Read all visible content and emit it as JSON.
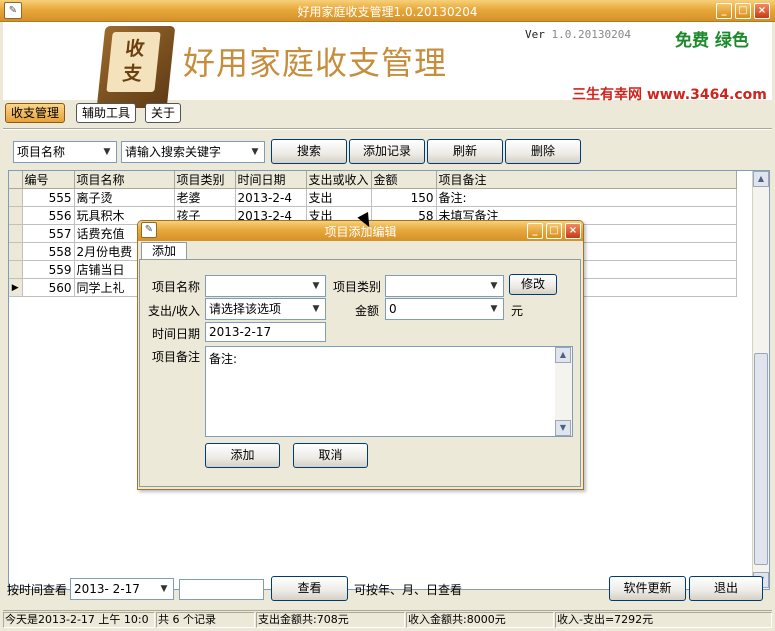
{
  "window": {
    "title": "好用家庭收支管理1.0.20130204",
    "icon": "app-book-icon"
  },
  "header": {
    "logo_text_1": "收",
    "logo_text_2": "支",
    "app_title": "好用家庭收支管理",
    "version_prefix": "Ver",
    "version_num": "1.0.20130204",
    "slogan": "免费 绿色",
    "site": "三生有幸网 www.3464.com"
  },
  "menu": [
    {
      "label": "收支管理",
      "active": true
    },
    {
      "label": "辅助工具",
      "active": false
    },
    {
      "label": "关于",
      "active": false
    }
  ],
  "search": {
    "field_select": "项目名称",
    "keyword_placeholder": "请输入搜索关键字",
    "search_btn": "搜索",
    "add_btn": "添加记录",
    "refresh_btn": "刷新",
    "delete_btn": "删除"
  },
  "grid": {
    "columns": [
      "编号",
      "项目名称",
      "项目类别",
      "时间日期",
      "支出或收入",
      "金额",
      "项目备注"
    ],
    "rows": [
      [
        "555",
        "离子烫",
        "老婆",
        "2013-2-4",
        "支出",
        "150",
        "备注:"
      ],
      [
        "556",
        "玩具积木",
        "孩子",
        "2013-2-4",
        "支出",
        "58",
        "未填写备注"
      ],
      [
        "557",
        "话费充值",
        "",
        "",
        "",
        "",
        ""
      ],
      [
        "558",
        "2月份电费",
        "",
        "",
        "",
        "",
        ""
      ],
      [
        "559",
        "店铺当日",
        "",
        "",
        "",
        "",
        ""
      ],
      [
        "560",
        "同学上礼",
        "",
        "",
        "",
        "",
        ""
      ]
    ],
    "current_row_index": 5
  },
  "bottom": {
    "date_label": "按时间查看",
    "date_value": "2013- 2-17",
    "view_btn": "查看",
    "hint": "可按年、月、日查看",
    "update_btn": "软件更新",
    "exit_btn": "退出"
  },
  "status": {
    "today": "今天是2013-2-17 上午 10:0",
    "records": "共 6 个记录",
    "expense_total": "支出金额共:708元",
    "income_total": "收入金额共:8000元",
    "balance": "收入-支出=7292元"
  },
  "dialog": {
    "title": "项目添加编辑",
    "tab": "添加",
    "name_label": "项目名称",
    "name_value": "",
    "category_label": "项目类别",
    "category_value": "",
    "modify_btn": "修改",
    "type_label": "支出/收入",
    "type_value": "请选择该选项",
    "amount_label": "金额",
    "amount_value": "0",
    "amount_unit": "元",
    "date_label": "时间日期",
    "date_value": "2013-2-17",
    "note_label": "项目备注",
    "note_value": "备注:",
    "add_btn": "添加",
    "cancel_btn": "取消"
  }
}
